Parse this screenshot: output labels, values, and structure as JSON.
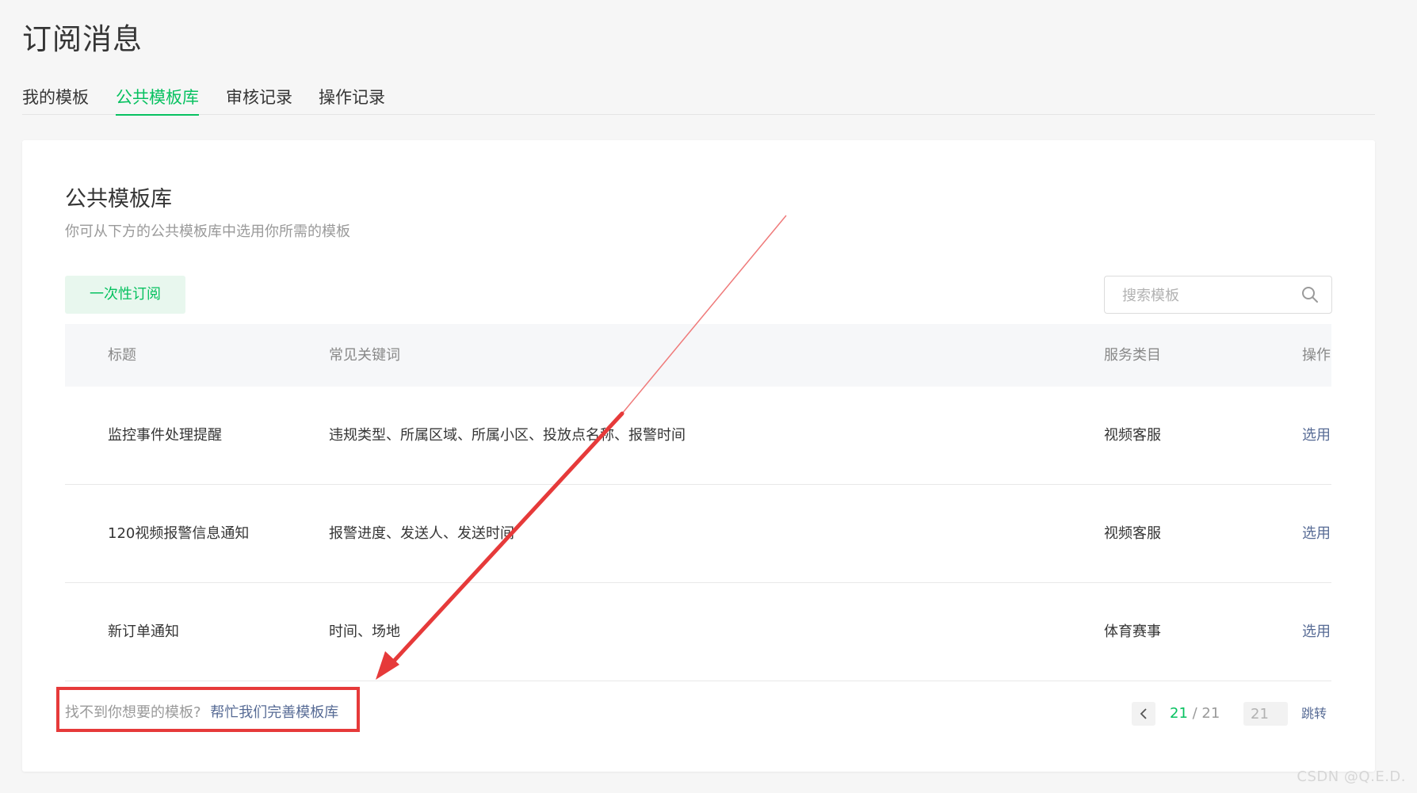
{
  "page": {
    "title": "订阅消息"
  },
  "tabs": [
    {
      "label": "我的模板",
      "active": false
    },
    {
      "label": "公共模板库",
      "active": true
    },
    {
      "label": "审核记录",
      "active": false
    },
    {
      "label": "操作记录",
      "active": false
    }
  ],
  "card": {
    "title": "公共模板库",
    "description": "你可从下方的公共模板库中选用你所需的模板"
  },
  "filter": {
    "label": "一次性订阅"
  },
  "search": {
    "placeholder": "搜索模板",
    "value": "",
    "icon": "search-icon"
  },
  "table": {
    "headers": {
      "title": "标题",
      "keywords": "常见关键词",
      "category": "服务类目",
      "action": "操作"
    },
    "rows": [
      {
        "title": "监控事件处理提醒",
        "keywords": "违规类型、所属区域、所属小区、投放点名称、报警时间",
        "category": "视频客服",
        "action": "选用"
      },
      {
        "title": "120视频报警信息通知",
        "keywords": "报警进度、发送人、发送时间",
        "category": "视频客服",
        "action": "选用"
      },
      {
        "title": "新订单通知",
        "keywords": "时间、场地",
        "category": "体育赛事",
        "action": "选用"
      }
    ]
  },
  "footer": {
    "hint": "找不到你想要的模板?",
    "link": "帮忙我们完善模板库"
  },
  "pagination": {
    "current": "21",
    "separator": " / ",
    "total": "21",
    "input_value": "21",
    "jump_label": "跳转",
    "prev_icon": "chevron-left-icon"
  },
  "watermark": "CSDN @Q.E.D.",
  "colors": {
    "accent": "#07c160",
    "link": "#576b95",
    "annotation": "#e63a3a"
  }
}
